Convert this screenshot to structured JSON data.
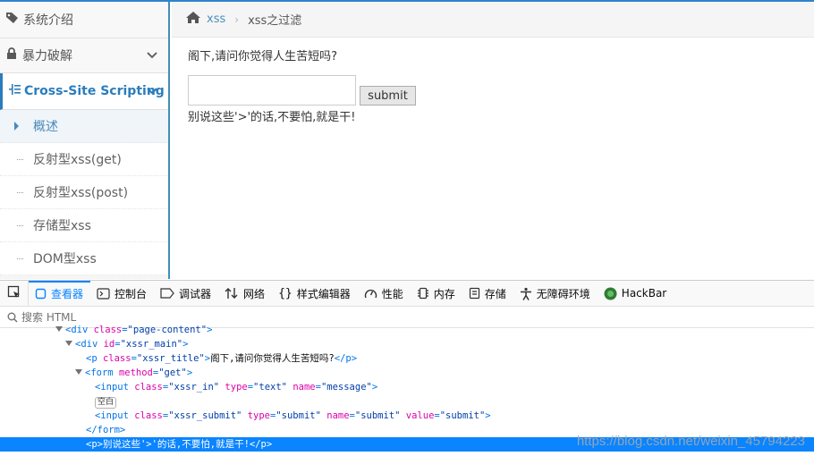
{
  "sidebar": {
    "intro": "系统介绍",
    "brute": "暴力破解",
    "xss": "Cross-Site Scripting",
    "subitems": [
      "概述",
      "反射型xss(get)",
      "反射型xss(post)",
      "存储型xss",
      "DOM型xss"
    ]
  },
  "breadcrumb": {
    "home": "xss",
    "current": "xss之过滤"
  },
  "main": {
    "question": "阁下,请问你觉得人生苦短吗?",
    "input_value": "",
    "submit": "submit",
    "echo": "别说这些'>'的话,不要怕,就是干!"
  },
  "devtools": {
    "tabs": [
      "查看器",
      "控制台",
      "调试器",
      "网络",
      "样式编辑器",
      "性能",
      "内存",
      "存储",
      "无障碍环境",
      "HackBar"
    ],
    "search_placeholder": "搜索 HTML",
    "badge": "空白",
    "watermark": "https://blog.csdn.net/weixin_45794223"
  },
  "colors": {
    "accent": "#2b7dbc",
    "devtools_active": "#0a84ff"
  }
}
